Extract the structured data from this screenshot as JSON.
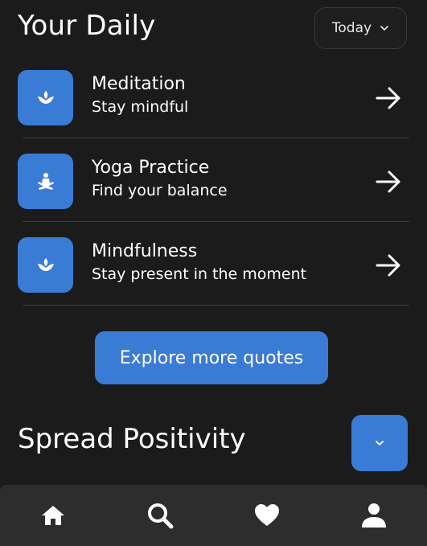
{
  "header": {
    "title": "Your Daily",
    "period_select": {
      "value": "Today",
      "icon": "chevron-down-icon"
    }
  },
  "activities": [
    {
      "title": "Meditation",
      "subtitle": "Stay mindful",
      "icon": "lotus-icon"
    },
    {
      "title": "Yoga Practice",
      "subtitle": "Find your balance",
      "icon": "yoga-pose-icon"
    },
    {
      "title": "Mindfulness",
      "subtitle": "Stay present in the moment",
      "icon": "lotus-icon"
    }
  ],
  "explore_button": {
    "label": "Explore more quotes"
  },
  "section": {
    "title": "Spread Positivity",
    "expand_icon": "chevron-down-icon"
  },
  "bottom_nav": {
    "items": [
      {
        "icon": "home-icon"
      },
      {
        "icon": "search-icon"
      },
      {
        "icon": "heart-icon"
      },
      {
        "icon": "user-icon"
      }
    ]
  },
  "colors": {
    "background": "#1b1b1b",
    "accent": "#3a7bd5",
    "nav_background": "#2d2d2d",
    "divider": "#3b3b3b",
    "text": "#ffffff"
  }
}
